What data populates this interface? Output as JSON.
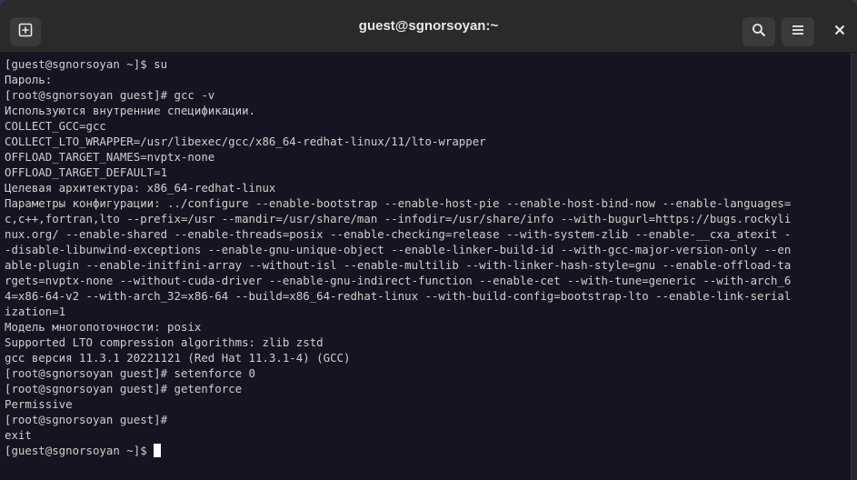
{
  "window": {
    "title": "guest@sgnorsoyan:~"
  },
  "titlebar": {
    "new_tab_icon": "new-tab-icon",
    "search_icon": "search-icon",
    "menu_icon": "hamburger-menu-icon",
    "close_icon": "close-icon"
  },
  "terminal": {
    "lines": [
      "[guest@sgnorsoyan ~]$ su",
      "Пароль:",
      "[root@sgnorsoyan guest]# gcc -v",
      "Используются внутренние спецификации.",
      "COLLECT_GCC=gcc",
      "COLLECT_LTO_WRAPPER=/usr/libexec/gcc/x86_64-redhat-linux/11/lto-wrapper",
      "OFFLOAD_TARGET_NAMES=nvptx-none",
      "OFFLOAD_TARGET_DEFAULT=1",
      "Целевая архитектура: x86_64-redhat-linux",
      "Параметры конфигурации: ../configure --enable-bootstrap --enable-host-pie --enable-host-bind-now --enable-languages=",
      "c,c++,fortran,lto --prefix=/usr --mandir=/usr/share/man --infodir=/usr/share/info --with-bugurl=https://bugs.rockyli",
      "nux.org/ --enable-shared --enable-threads=posix --enable-checking=release --with-system-zlib --enable-__cxa_atexit -",
      "-disable-libunwind-exceptions --enable-gnu-unique-object --enable-linker-build-id --with-gcc-major-version-only --en",
      "able-plugin --enable-initfini-array --without-isl --enable-multilib --with-linker-hash-style=gnu --enable-offload-ta",
      "rgets=nvptx-none --without-cuda-driver --enable-gnu-indirect-function --enable-cet --with-tune=generic --with-arch_6",
      "4=x86-64-v2 --with-arch_32=x86-64 --build=x86_64-redhat-linux --with-build-config=bootstrap-lto --enable-link-serial",
      "ization=1",
      "Модель многопоточности: posix",
      "Supported LTO compression algorithms: zlib zstd",
      "gcc версия 11.3.1 20221121 (Red Hat 11.3.1-4) (GCC)",
      "[root@sgnorsoyan guest]# setenforce 0",
      "[root@sgnorsoyan guest]# getenforce",
      "Permissive",
      "[root@sgnorsoyan guest]#",
      "exit",
      "[guest@sgnorsoyan ~]$ "
    ]
  },
  "colors": {
    "terminal_bg": "#171421",
    "terminal_fg": "#d0cfcc",
    "titlebar_bg": "#2a2a2a"
  }
}
